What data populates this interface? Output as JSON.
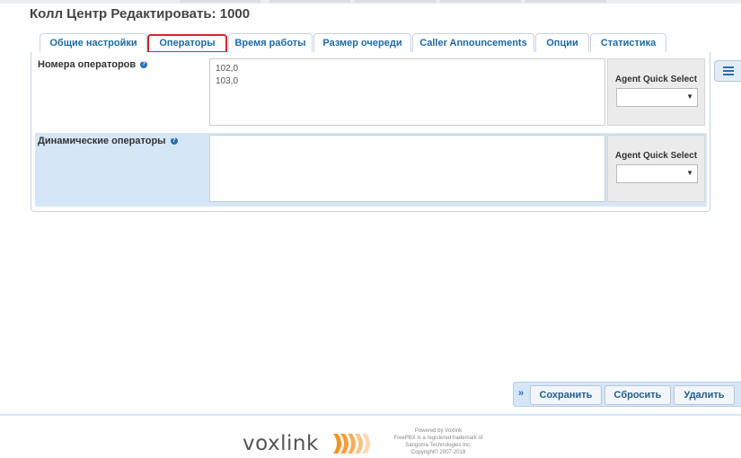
{
  "page": {
    "title": "Колл Центр Редактировать: 1000"
  },
  "tabs": [
    {
      "label": "Общие настройки"
    },
    {
      "label": "Операторы",
      "active": true
    },
    {
      "label": "Время работы"
    },
    {
      "label": "Размер очереди"
    },
    {
      "label": "Caller Announcements"
    },
    {
      "label": "Опции"
    },
    {
      "label": "Статистика"
    }
  ],
  "form": {
    "static_agents": {
      "label": "Номера операторов",
      "value": "102,0\n103,0",
      "quick_select_label": "Agent Quick Select",
      "quick_select_value": ""
    },
    "dynamic_agents": {
      "label": "Динамические операторы",
      "value": "",
      "quick_select_label": "Agent Quick Select",
      "quick_select_value": ""
    }
  },
  "actions": {
    "submit": "Сохранить",
    "reset": "Сбросить",
    "delete": "Удалить"
  },
  "footer": {
    "logo_text": "voxlink",
    "powered_by": "Powered by Voxlink",
    "trademark_line1": "FreePBX is a registered trademark of",
    "trademark_line2": "Sangoma Technologies Inc.",
    "copyright": "Copyright© 2007-2018"
  },
  "colors": {
    "accent": "#1e6aa3",
    "active_tab_border": "#d9232e",
    "row_highlight": "#d5e6f7",
    "logo_orange": "#f39321"
  },
  "icons": {
    "help": "help-circle-icon",
    "side_menu": "list-icon",
    "action_toggle": "double-chevron-right-icon",
    "select_arrow": "caret-down-icon"
  }
}
